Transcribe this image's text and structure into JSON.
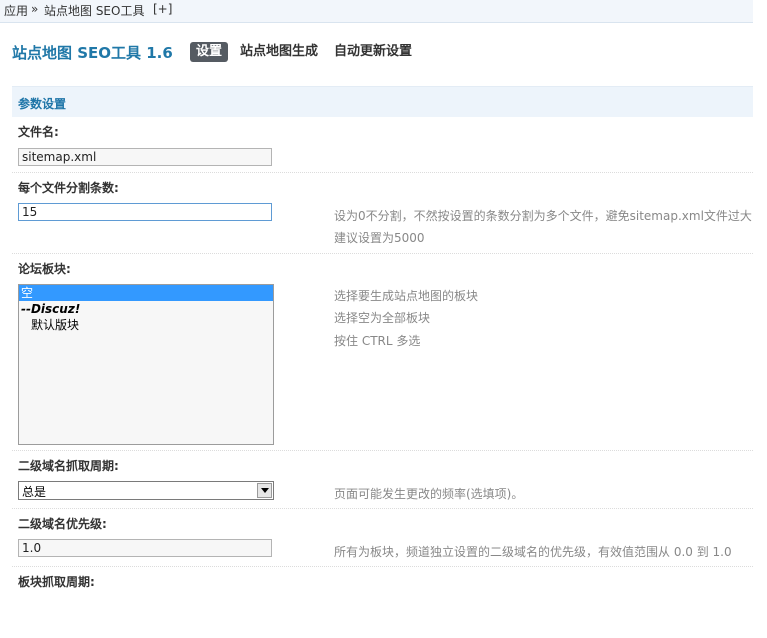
{
  "breadcrumb": {
    "root": "应用",
    "separator": "»",
    "current": "站点地图 SEO工具",
    "add": "[+]"
  },
  "header": {
    "title": "站点地图 SEO工具 1.6",
    "tabs": [
      {
        "label": "设置",
        "active": true
      },
      {
        "label": "站点地图生成",
        "active": false
      },
      {
        "label": "自动更新设置",
        "active": false
      }
    ]
  },
  "section": {
    "title": "参数设置"
  },
  "fields": {
    "filename": {
      "label": "文件名:",
      "value": "sitemap.xml"
    },
    "split": {
      "label": "每个文件分割条数:",
      "value": "15",
      "help_line1": "设为0不分割，不然按设置的条数分割为多个文件，避免sitemap.xml文件过大",
      "help_line2": "建议设置为5000"
    },
    "forums": {
      "label": "论坛板块:",
      "options": [
        {
          "label": "空",
          "selected": true
        },
        {
          "label": "--Discuz!",
          "group": true
        },
        {
          "label": "默认版块",
          "child": true
        }
      ],
      "help_line1": "选择要生成站点地图的板块",
      "help_line2": "选择空为全部板块",
      "help_line3": "按住 CTRL 多选"
    },
    "subdomain_freq": {
      "label": "二级域名抓取周期:",
      "value": "总是",
      "help": "页面可能发生更改的频率(选填项)。"
    },
    "subdomain_priority": {
      "label": "二级域名优先级:",
      "value": "1.0",
      "help": "所有为板块，频道独立设置的二级域名的优先级，有效值范围从 0.0 到 1.0"
    },
    "forum_freq": {
      "label": "板块抓取周期:"
    }
  },
  "colors": {
    "accent": "#2078a8",
    "section_bg": "#edf4fb",
    "selected_option": "#3399ff",
    "active_tab_bg": "#555b62"
  }
}
